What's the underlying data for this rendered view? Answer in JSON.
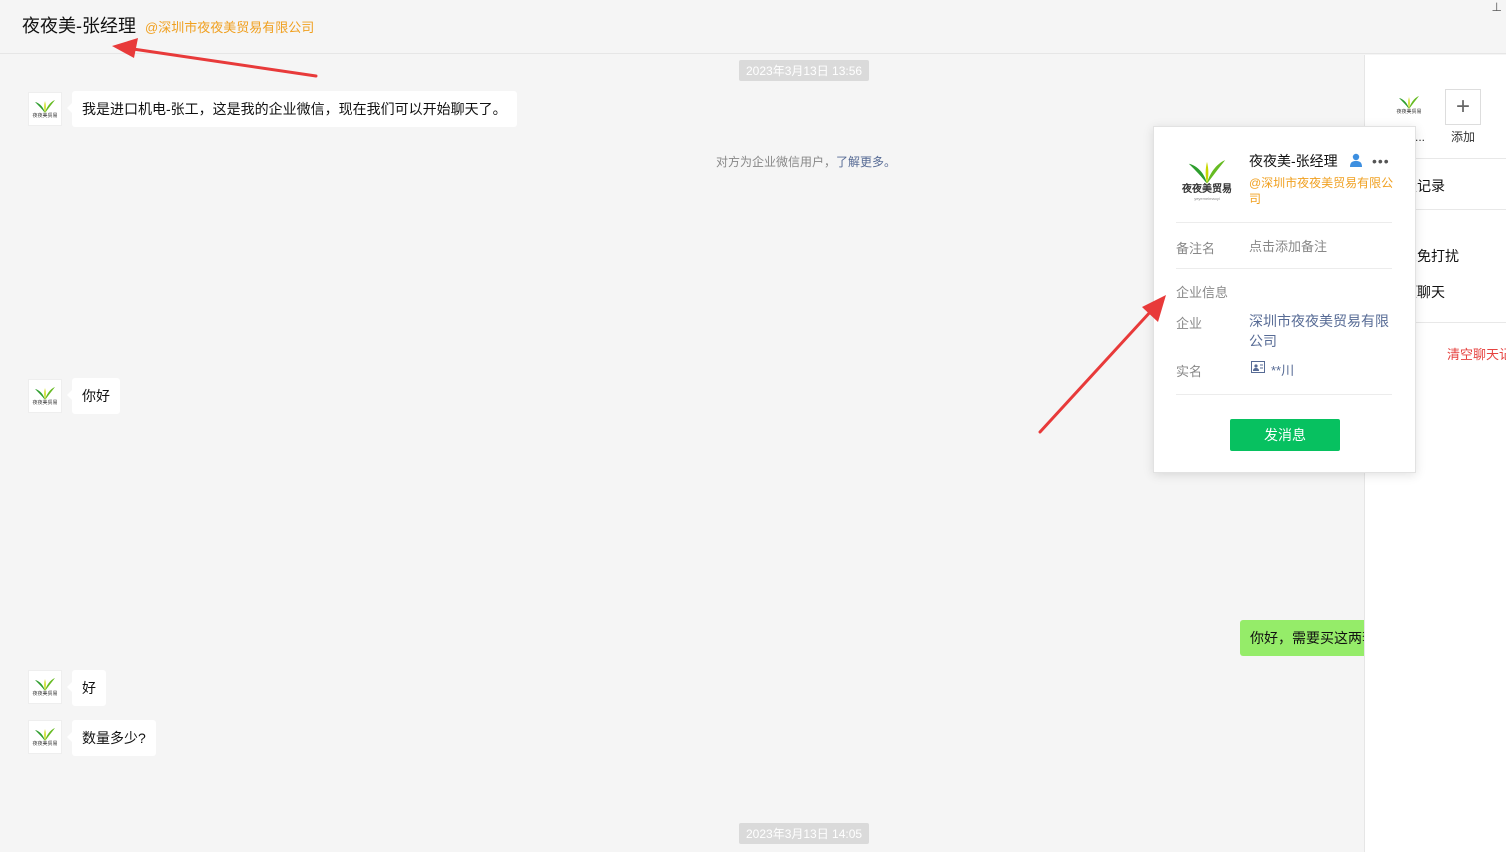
{
  "header": {
    "title": "夜夜美-张经理",
    "corp": "@深圳市夜夜美贸易有限公司"
  },
  "avatar": {
    "brand": "夜夜美贸易",
    "sub": "yeyemeimaoyi"
  },
  "chat": {
    "timestamps": [
      "2023年3月13日 13:56",
      "2023年3月13日 14:05"
    ],
    "system_note": {
      "text": "对方为企业微信用户，",
      "link": "了解更多。"
    },
    "messages": [
      {
        "from": "them",
        "text": "我是进口机电-张工，这是我的企业微信，现在我们可以开始聊天了。"
      },
      {
        "from": "them",
        "text": "你好"
      },
      {
        "from": "me",
        "text": "你好，需要买这两套"
      },
      {
        "from": "them",
        "text": "好"
      },
      {
        "from": "them",
        "text": "数量多少?"
      }
    ]
  },
  "side": {
    "avatar_name": "夜...",
    "add_label": "添加",
    "items": [
      "聊天记录",
      "消息免打扰",
      "置顶聊天",
      "清空聊天记录"
    ]
  },
  "card": {
    "name": "夜夜美-张经理",
    "corp": "@深圳市夜夜美贸易有限公司",
    "remark_label": "备注名",
    "remark_placeholder": "点击添加备注",
    "section_label": "企业信息",
    "company_label": "企业",
    "company_value": "深圳市夜夜美贸易有限公司",
    "realname_label": "实名",
    "realname_value": "**川",
    "send_button": "发消息"
  },
  "colors": {
    "accent_green": "#07c160",
    "bubble_mine": "#95ec69",
    "corp_orange": "#f0a020",
    "link_blue": "#576b95",
    "danger_red": "#e64340",
    "annotation_red": "#e83a3a"
  }
}
